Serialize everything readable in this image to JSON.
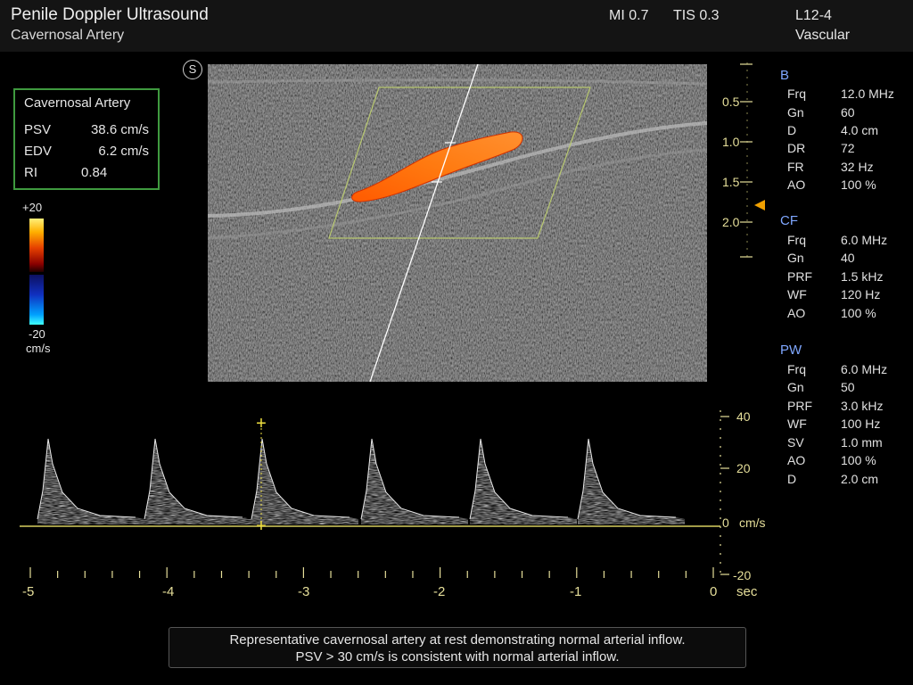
{
  "header": {
    "title": "Penile Doppler Ultrasound",
    "subtitle": "Cavernosal Artery",
    "mi": "MI 0.7",
    "tis": "TIS 0.3",
    "probe": "L12-4",
    "preset": "Vascular"
  },
  "measurements": {
    "title": "Cavernosal Artery",
    "rows": [
      {
        "label": "PSV",
        "value": "38.6 cm/s"
      },
      {
        "label": "EDV",
        "value": "6.2 cm/s"
      },
      {
        "label": "RI",
        "value": "0.84"
      }
    ]
  },
  "color_bar": {
    "top_label": "+20",
    "bottom_label": "-20",
    "unit": "cm/s"
  },
  "s_marker": "S",
  "depth_scale": [
    "0.5",
    "1.0",
    "1.5",
    "2.0"
  ],
  "focus_marker_color": "#f0a000",
  "params": {
    "b": {
      "title": "B",
      "rows": [
        {
          "k": "Frq",
          "v": "12.0 MHz"
        },
        {
          "k": "Gn",
          "v": "60"
        },
        {
          "k": "D",
          "v": "4.0 cm"
        },
        {
          "k": "DR",
          "v": "72"
        },
        {
          "k": "FR",
          "v": "32 Hz"
        },
        {
          "k": "AO",
          "v": "100 %"
        }
      ]
    },
    "cf": {
      "title": "CF",
      "rows": [
        {
          "k": "Frq",
          "v": "6.0 MHz"
        },
        {
          "k": "Gn",
          "v": "40"
        },
        {
          "k": "PRF",
          "v": "1.5 kHz"
        },
        {
          "k": "WF",
          "v": "120 Hz"
        },
        {
          "k": "AO",
          "v": "100 %"
        }
      ]
    },
    "pw": {
      "title": "PW",
      "rows": [
        {
          "k": "Frq",
          "v": "6.0 MHz"
        },
        {
          "k": "Gn",
          "v": "50"
        },
        {
          "k": "PRF",
          "v": "3.0 kHz"
        },
        {
          "k": "WF",
          "v": "100 Hz"
        },
        {
          "k": "SV",
          "v": "1.0 mm"
        },
        {
          "k": "AO",
          "v": "100 %"
        },
        {
          "k": "D",
          "v": "2.0 cm"
        }
      ]
    }
  },
  "spectral": {
    "velocity_labels": [
      "40",
      "20",
      "0",
      "-20"
    ],
    "velocity_unit": "cm/s",
    "time_labels": [
      "-5",
      "-4",
      "-3",
      "-2",
      "-1",
      "0"
    ],
    "time_unit": "sec"
  },
  "caption": {
    "line1": "Representative cavernosal artery at rest demonstrating normal arterial inflow.",
    "line2": "PSV > 30 cm/s is consistent with normal arterial inflow."
  }
}
